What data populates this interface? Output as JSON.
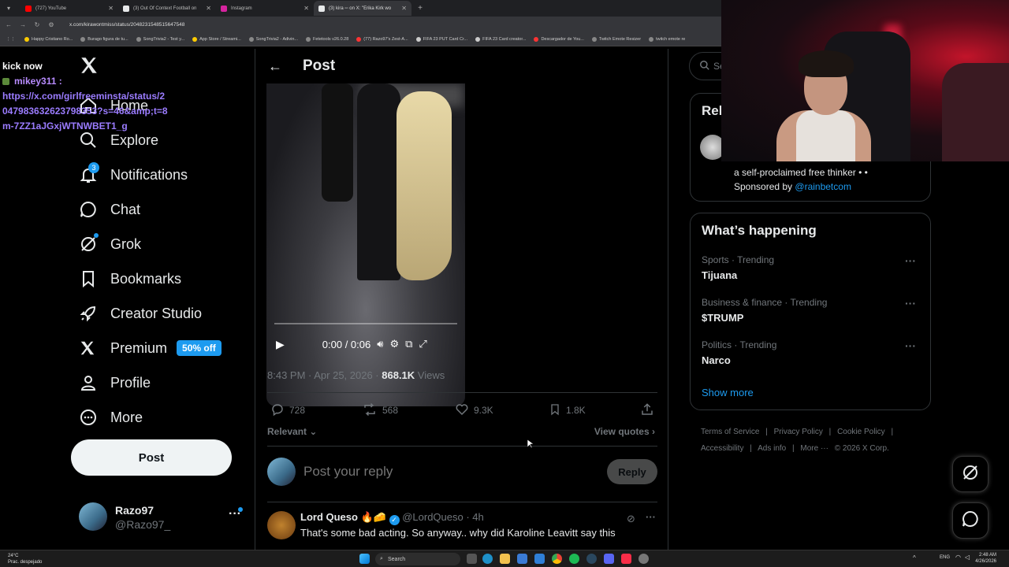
{
  "browser": {
    "tabs": [
      {
        "title": "(727) YouTube",
        "color": "#ff0000"
      },
      {
        "title": "(3) Out Of Context Football on",
        "color": "#e7e9ea"
      },
      {
        "title": "Instagram",
        "color": "#d6249f"
      },
      {
        "title": "(3) kira ▫▫ on X: \"Erika Kirk wo",
        "color": "#e7e9ea"
      }
    ],
    "url": "x.com/kirawontmiss/status/2048231548515647548",
    "bookmarks": [
      "Happy Cristiano Ro...",
      "Burago figura de tu...",
      "SongTrivia2 - Test y...",
      "App Store / Streami...",
      "SongTrivia2 - Adivin...",
      "Fetetools v26.0.28",
      "(77) Razo97's Zest-A...",
      "FIFA 23 PUT Card Cr...",
      "FIFA 23 Card creator...",
      "Descargador de You...",
      "Twitch Emote Resizer",
      "twitch emote re"
    ]
  },
  "overlay": {
    "header": "kick now",
    "user": "mikey311 :",
    "message": "https://x.com/girlfreeminsta/status/2047983632623798353?s=46&amp;t=8m-7ZZ1aJGxjWTNWBET1_g"
  },
  "nav": {
    "items": [
      {
        "label": "Home",
        "icon": "home-icon"
      },
      {
        "label": "Explore",
        "icon": "search-icon"
      },
      {
        "label": "Notifications",
        "icon": "bell-icon",
        "badge": "3"
      },
      {
        "label": "Chat",
        "icon": "chat-icon"
      },
      {
        "label": "Grok",
        "icon": "grok-icon"
      },
      {
        "label": "Bookmarks",
        "icon": "bookmark-icon"
      },
      {
        "label": "Creator Studio",
        "icon": "rocket-icon"
      },
      {
        "label": "Premium",
        "icon": "x-logo-icon",
        "badge": "50% off"
      },
      {
        "label": "Profile",
        "icon": "person-icon"
      },
      {
        "label": "More",
        "icon": "more-circle-icon"
      }
    ],
    "post_button": "Post",
    "account": {
      "name": "Razo97",
      "handle": "@Razo97_"
    }
  },
  "post": {
    "header": "Post",
    "video_time": "0:00 / 0:06",
    "timestamp": "8:43 PM · Apr 25, 2026 · ",
    "views_count": "868.1K",
    "views_label": " Views",
    "replies": "728",
    "reposts": "568",
    "likes": "9.3K",
    "bookmarks": "1.8K",
    "sort_label": "Relevant",
    "view_quotes": "View quotes",
    "reply_placeholder": "Post your reply",
    "reply_button": "Reply"
  },
  "reply": {
    "name": "Lord Queso",
    "emoji": "🔥🧀",
    "handle": "@LordQueso",
    "age": "· 4h",
    "text": "That's some bad acting. So anyway..  why did Karoline Leavitt say this"
  },
  "sidebar": {
    "search_placeholder": "Se",
    "relevant_title": "Rel",
    "relevant_text": "a self-proclaimed free thinker • •",
    "sponsored_prefix": "Sponsored by ",
    "sponsored_link": "@rainbetcom",
    "happening_title": "What’s happening",
    "trends": [
      {
        "category": "Sports · Trending",
        "name": "Tijuana"
      },
      {
        "category": "Business & finance · Trending",
        "name": "$TRUMP"
      },
      {
        "category": "Politics · Trending",
        "name": "Narco"
      }
    ],
    "show_more": "Show more",
    "footer": [
      "Terms of Service",
      "|",
      "Privacy Policy",
      "|",
      "Cookie Policy",
      "|",
      "Accessibility",
      "|",
      "Ads info",
      "|",
      "More ···",
      "© 2026 X Corp."
    ]
  },
  "taskbar": {
    "weather_temp": "24°C",
    "weather_desc": "Prac. despejado",
    "search": "Search",
    "lang": "ENG",
    "time": "2:48 AM",
    "date": "4/26/2026"
  },
  "colors": {
    "accent": "#1d9bf0",
    "overlay_text": "#9b7cff",
    "bg": "#000000"
  }
}
